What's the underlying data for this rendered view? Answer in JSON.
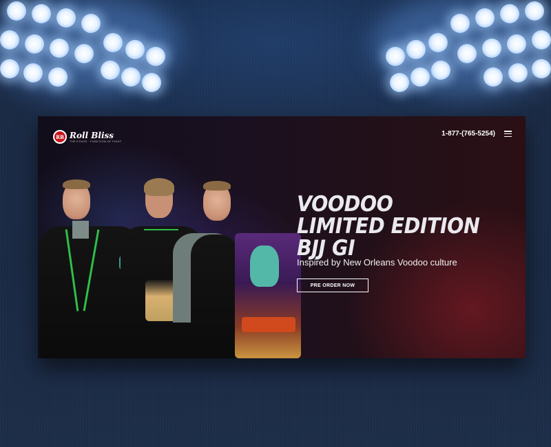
{
  "header": {
    "logo_name": "Roll Bliss",
    "logo_monogram": "RB",
    "logo_tagline": "THE ETHOS · FUNCTION OF FIGHT",
    "phone": "1-877-(765-5254)",
    "menu_icon": "hamburger-menu-icon"
  },
  "hero": {
    "title": "VOODOO LIMITED EDITION BJJ GI",
    "subtitle": "Inspired by New Orleans Voodoo culture",
    "cta_label": "PRE ORDER NOW"
  },
  "colors": {
    "brand_red": "#c4161c",
    "gi_trim": "#2fbf4a",
    "background": "#1a2a44"
  }
}
